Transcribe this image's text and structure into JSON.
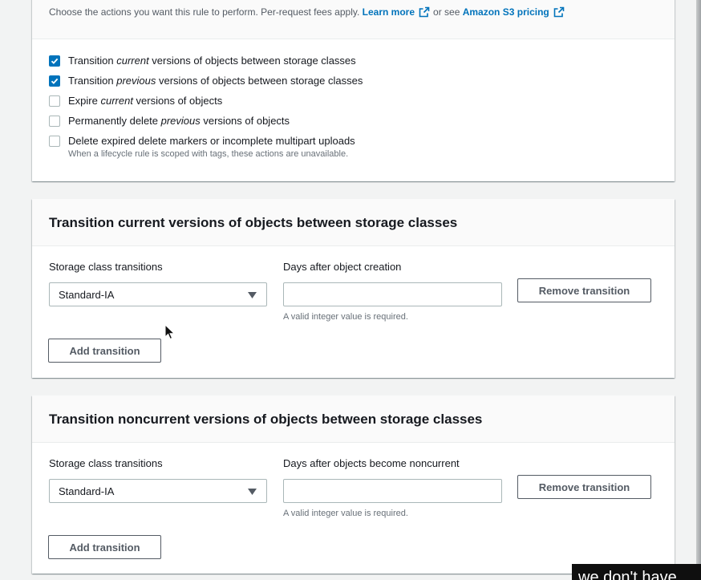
{
  "actions": {
    "description": "Choose the actions you want this rule to perform. Per-request fees apply.",
    "learn_more": "Learn more",
    "or_see": "or see",
    "pricing_link": "Amazon S3 pricing",
    "options": [
      {
        "pre": "Transition ",
        "em": "current",
        "post": " versions of objects between storage classes",
        "checked": true
      },
      {
        "pre": "Transition ",
        "em": "previous",
        "post": " versions of objects between storage classes",
        "checked": true
      },
      {
        "pre": "Expire ",
        "em": "current",
        "post": " versions of objects",
        "checked": false
      },
      {
        "pre": "Permanently delete ",
        "em": "previous",
        "post": " versions of objects",
        "checked": false
      },
      {
        "pre": "Delete expired delete markers or incomplete multipart uploads",
        "em": "",
        "post": "",
        "checked": false,
        "note": "When a lifecycle rule is scoped with tags, these actions are unavailable."
      }
    ]
  },
  "current_transition": {
    "title": "Transition current versions of objects between storage classes",
    "storage_label": "Storage class transitions",
    "days_label": "Days after object creation",
    "selected_class": "Standard-IA",
    "days_value": "",
    "hint": "A valid integer value is required.",
    "remove_label": "Remove transition",
    "add_label": "Add transition"
  },
  "noncurrent_transition": {
    "title": "Transition noncurrent versions of objects between storage classes",
    "storage_label": "Storage class transitions",
    "days_label": "Days after objects become noncurrent",
    "selected_class": "Standard-IA",
    "days_value": "",
    "hint": "A valid integer value is required.",
    "remove_label": "Remove transition",
    "add_label": "Add transition"
  },
  "caption": {
    "text": "we don't have"
  },
  "colors": {
    "accent": "#0073bb",
    "background": "#f2f3f3",
    "text": "#16191f"
  },
  "icons": [
    "external-link-icon",
    "checkmark-icon",
    "caret-down-icon",
    "mouse-cursor-icon"
  ]
}
